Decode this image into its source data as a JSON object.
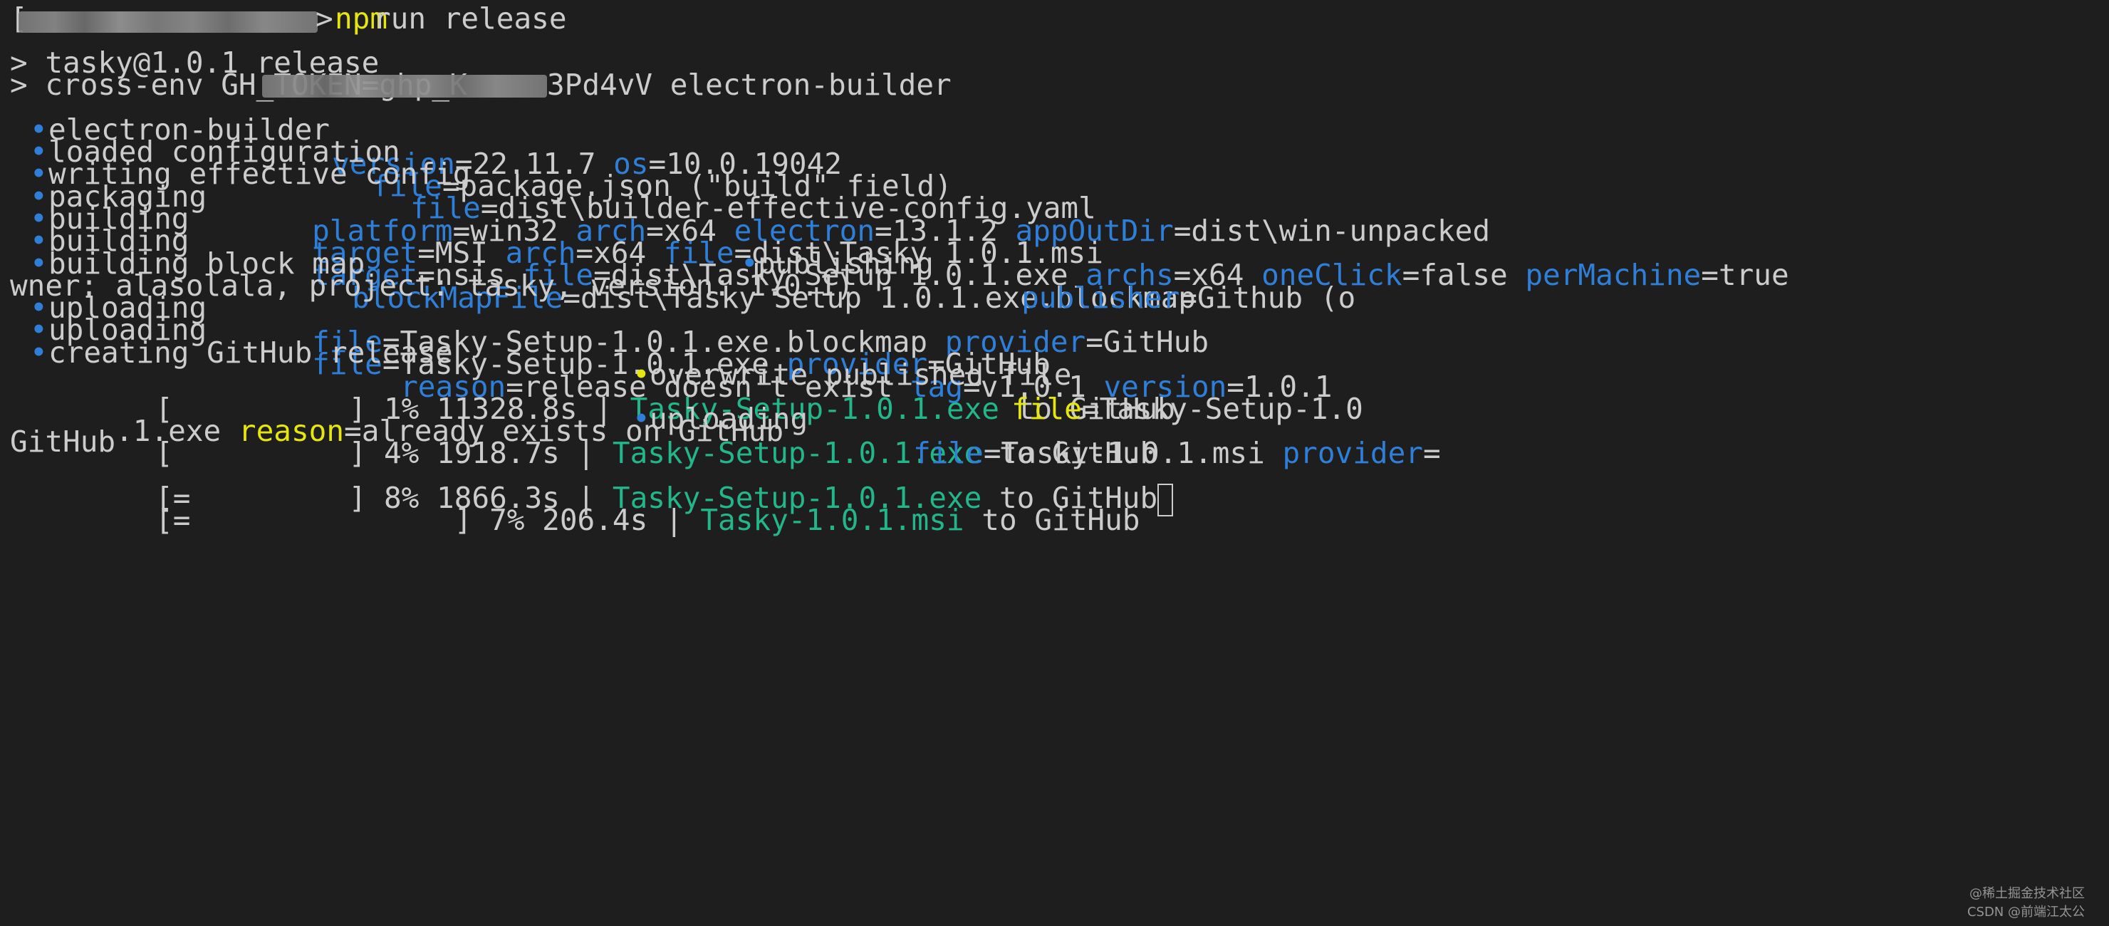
{
  "prompt": {
    "path_redacted": "[redacted path]",
    "symbol": ">",
    "command_name": "npm",
    "command_args": "run release"
  },
  "script": {
    "line1": "> tasky@1.0.1 release",
    "line2_prefix": "> cross-env GH_TOKEN=ghp_K",
    "line2_suffix": "3Pd4vV electron-builder"
  },
  "builder": {
    "bullet": "•",
    "l1": {
      "label": "electron-builder",
      "k1": "version",
      "v1": "=22.11.7 ",
      "k2": "os",
      "v2": "=10.0.19042"
    },
    "l2": {
      "label": "loaded configuration",
      "k1": "file",
      "v1": "=package.json (\"build\" field)"
    },
    "l3": {
      "label": "writing effective config",
      "k1": "file",
      "v1": "=dist\\builder-effective-config.yaml"
    },
    "l4": {
      "label": "packaging",
      "k1": "platform",
      "v1": "=win32 ",
      "k2": "arch",
      "v2": "=x64 ",
      "k3": "electron",
      "v3": "=13.1.2 ",
      "k4": "appOutDir",
      "v4": "=dist\\win-unpacked"
    },
    "l5": {
      "label": "building",
      "k1": "target",
      "v1": "=MSI ",
      "k2": "arch",
      "v2": "=x64 ",
      "k3": "file",
      "v3": "=dist\\Tasky 1.0.1.msi"
    },
    "l6": {
      "label": "building",
      "k1": "target",
      "v1": "=nsis ",
      "k2": "file",
      "v2": "=dist\\Tasky Setup 1.0.1.exe ",
      "k3": "archs",
      "v3": "=x64 ",
      "k4": "oneClick",
      "v4": "=false ",
      "k5": "perMachine",
      "v5": "=true"
    },
    "l7": {
      "label": "building block map",
      "k1": "blockMapFile",
      "v1": "=dist\\Tasky Setup 1.0.1.exe.blockmap",
      "label2": "publishing",
      "k2": "publisher",
      "v2": "=Github (o"
    },
    "l7_wrap": "wner: alasolala, project: tasky, version: 1.0.1)",
    "l8": {
      "label": "uploading",
      "k1": "file",
      "v1": "=Tasky-Setup-1.0.1.exe.blockmap ",
      "k2": "provider",
      "v2": "=GitHub"
    },
    "l9": {
      "label": "uploading",
      "k1": "file",
      "v1": "=Tasky-Setup-1.0.1.exe ",
      "k2": "provider",
      "v2": "=GitHub"
    },
    "l10": {
      "label": "creating GitHub release",
      "k1": "reason",
      "v1": "=release doesn't exist ",
      "k2": "tag",
      "v2": "=v1.0.1 ",
      "k3": "version",
      "v3": "=1.0.1"
    }
  },
  "progress": {
    "p1": {
      "bar": "[          ] 1% 11328.8s | ",
      "file": "Tasky-Setup-1.0.1.exe",
      "dest": " to GitHub",
      "bullet": "•",
      "label": "overwrite published file",
      "k1": "file",
      "v1": "=Tasky-Setup-1.0",
      "wrap_v1": ".1.exe ",
      "k2": "reason",
      "v2": "=already exists on GitHub"
    },
    "p2": {
      "bar": "[          ] 4% 1918.7s | ",
      "file": "Tasky-Setup-1.0.1.exe",
      "dest": " to GitHub",
      "bullet": "•",
      "label": "uploading",
      "k1": "file",
      "v1": "=Tasky-1.0.1.msi ",
      "k2": "provider",
      "v2": "=",
      "wrap": "GitHub"
    },
    "p3": {
      "bar": "[=         ] 8% 1866.3s | ",
      "file": "Tasky-Setup-1.0.1.exe",
      "dest": " to GitHub"
    },
    "p4": {
      "bar": "[=               ] 7% 206.4s | ",
      "file": "Tasky-1.0.1.msi",
      "dest": " to GitHub"
    }
  },
  "watermark": {
    "line1": "@稀土掘金技术社区",
    "line2": "CSDN @前端江太公"
  },
  "colors": {
    "background": "#1e1e1e",
    "text": "#cccccc",
    "key_blue": "#2f7fd8",
    "file_green": "#23b68a",
    "warn_yellow": "#e5e510"
  }
}
